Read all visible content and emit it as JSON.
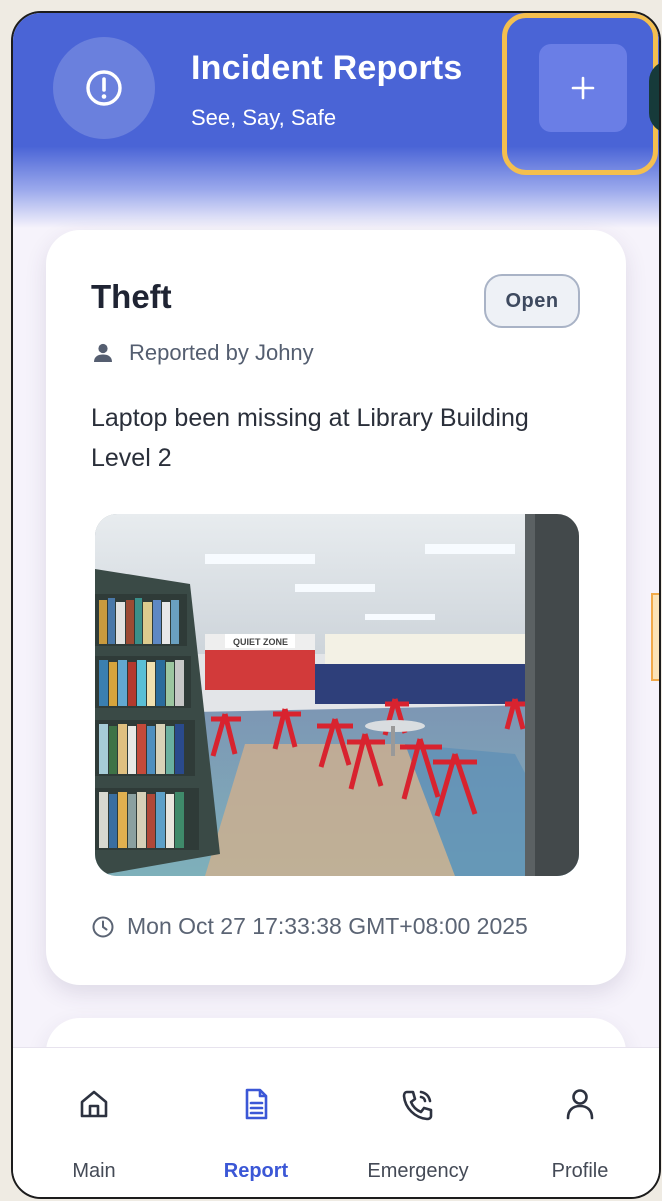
{
  "header": {
    "title": "Incident Reports",
    "subtitle": "See, Say, Safe",
    "add_button_label": "+",
    "alert_icon": "alert-circle-icon"
  },
  "report": {
    "title": "Theft",
    "status": "Open",
    "reporter": "Reported by Johny",
    "description": "Laptop been missing at Library Building Level 2",
    "timestamp": "Mon Oct 27 17:33:38 GMT+08:00 2025",
    "photo_sign_text": "QUIET ZONE"
  },
  "nav": {
    "items": [
      {
        "label": "Main",
        "icon": "home-icon"
      },
      {
        "label": "Report",
        "icon": "document-icon"
      },
      {
        "label": "Emergency",
        "icon": "phone-call-icon"
      },
      {
        "label": "Profile",
        "icon": "user-icon"
      }
    ],
    "active_index": 1
  },
  "colors": {
    "primary": "#4a64d6",
    "highlight": "#f4bf4f",
    "active_nav": "#3b57d6"
  }
}
